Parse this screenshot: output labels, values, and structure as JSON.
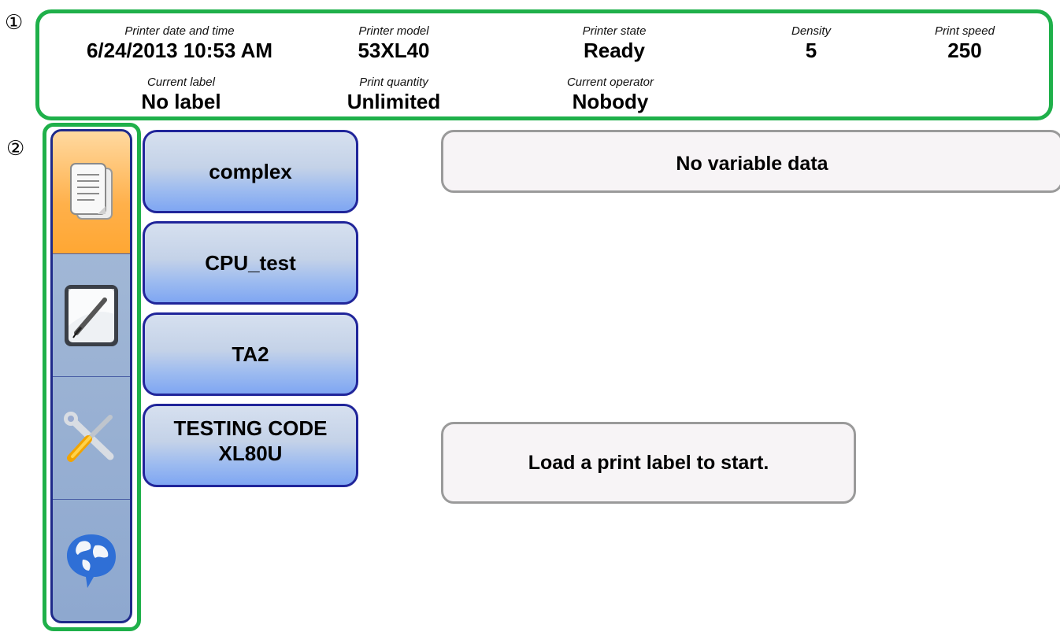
{
  "callouts": [
    "①",
    "②"
  ],
  "status": {
    "printer_date_time": {
      "label": "Printer date and time",
      "value": "6/24/2013 10:53 AM"
    },
    "printer_model": {
      "label": "Printer model",
      "value": "53XL40"
    },
    "printer_state": {
      "label": "Printer state",
      "value": "Ready"
    },
    "density": {
      "label": "Density",
      "value": "5"
    },
    "print_speed": {
      "label": "Print speed",
      "value": "250"
    },
    "current_label": {
      "label": "Current label",
      "value": "No label"
    },
    "print_quantity": {
      "label": "Print quantity",
      "value": "Unlimited"
    },
    "current_operator": {
      "label": "Current operator",
      "value": "Nobody"
    }
  },
  "nav": {
    "items": [
      {
        "icon": "document-list-icon",
        "active": true
      },
      {
        "icon": "pen-edit-icon",
        "active": false
      },
      {
        "icon": "tools-icon",
        "active": false
      },
      {
        "icon": "globe-chat-icon",
        "active": false
      }
    ]
  },
  "labels": {
    "items": [
      {
        "line1": "complex"
      },
      {
        "line1": "CPU_test"
      },
      {
        "line1": "TA2"
      },
      {
        "line1": "TESTING CODE",
        "line2": "XL80U"
      }
    ]
  },
  "variable_data_text": "No variable data",
  "start_message": "Load a print label to start.",
  "colors": {
    "outline_green": "#1fb04a",
    "nav_border": "#1f2a8a",
    "active_orange": "#ffa733",
    "button_blue": "#7fa6f2"
  }
}
